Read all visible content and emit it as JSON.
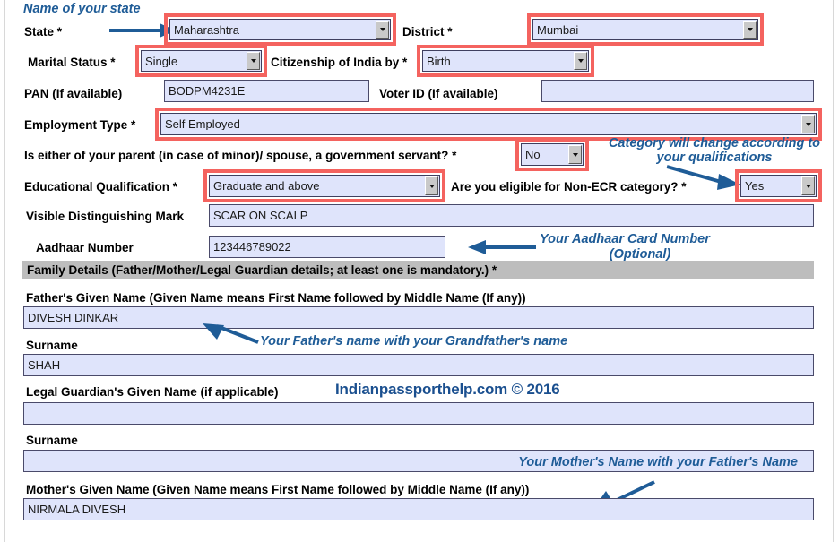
{
  "meta": {
    "accent_red": "#f4635f",
    "field_fill": "#dfe4fb",
    "annotation_blue": "#1f5c97",
    "banner_grey": "#bdbdbd"
  },
  "fields": {
    "state": {
      "label": "State *",
      "value": "Maharashtra",
      "type": "select",
      "highlighted": true
    },
    "district": {
      "label": "District *",
      "value": "Mumbai",
      "type": "select",
      "highlighted": true
    },
    "marital_status": {
      "label": "Marital Status *",
      "value": "Single",
      "type": "select",
      "highlighted": true
    },
    "citizenship": {
      "label": "Citizenship of India by *",
      "value": "Birth",
      "type": "select",
      "highlighted": true
    },
    "pan": {
      "label": "PAN (If available)",
      "value": "BODPM4231E",
      "type": "text",
      "highlighted": false
    },
    "voter_id": {
      "label": "Voter ID (If available)",
      "value": "",
      "type": "text",
      "highlighted": false
    },
    "employment_type": {
      "label": "Employment Type *",
      "value": "Self Employed",
      "type": "select",
      "highlighted": true
    },
    "govt_servant": {
      "label": "Is either of your parent (in case of minor)/ spouse, a government servant? *",
      "value": "No",
      "type": "select",
      "highlighted": true
    },
    "education": {
      "label": "Educational Qualification *",
      "value": "Graduate and above",
      "type": "select",
      "highlighted": true
    },
    "non_ecr": {
      "label": "Are you eligible for Non-ECR category? *",
      "value": "Yes",
      "type": "select",
      "highlighted": true
    },
    "visible_mark": {
      "label": "Visible Distinguishing Mark",
      "value": "SCAR ON SCALP",
      "type": "text",
      "highlighted": false
    },
    "aadhaar": {
      "label": "Aadhaar Number",
      "value": "123446789022",
      "type": "text",
      "highlighted": false
    }
  },
  "family_section": {
    "banner": "Family Details (Father/Mother/Legal Guardian details; at least one is mandatory.) *",
    "father_given_name": {
      "label": "Father's Given Name (Given Name means First Name followed by Middle Name (If any))",
      "value": "DIVESH DINKAR"
    },
    "father_surname": {
      "label": "Surname",
      "value": "SHAH"
    },
    "guardian_given_name": {
      "label": "Legal Guardian's Given Name (if applicable)",
      "value": ""
    },
    "guardian_surname": {
      "label": "Surname",
      "value": ""
    },
    "mother_given_name": {
      "label": "Mother's Given Name (Given Name means First Name followed by Middle Name (If any))",
      "value": "NIRMALA DIVESH"
    }
  },
  "annotations": {
    "state_note": "Name of your state",
    "category_note_line1": "Category will change according to",
    "category_note_line2": "your qualifications",
    "aadhaar_note_line1": "Your Aadhaar Card Number",
    "aadhaar_note_line2": "(Optional)",
    "father_note": "Your Father's name with your Grandfather's name",
    "mother_note": "Your Mother's Name with your Father's Name",
    "watermark": "Indianpassporthelp.com © 2016"
  }
}
